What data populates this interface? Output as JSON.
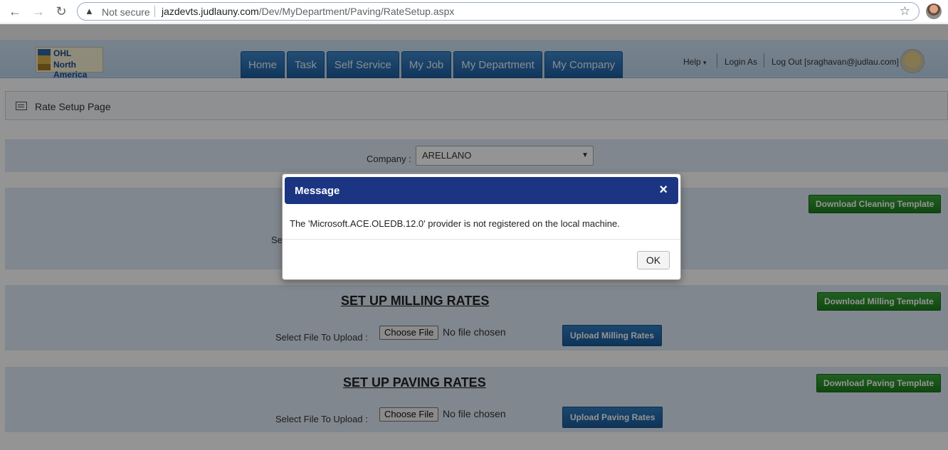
{
  "browser": {
    "security_label": "Not secure",
    "url_host": "jazdevts.judlauny.com",
    "url_path": "/Dev/MyDepartment/Paving/RateSetup.aspx"
  },
  "logo": {
    "line1": "OHL",
    "line2": "North America"
  },
  "nav": {
    "items": [
      "Home",
      "Task",
      "Self Service",
      "My Job",
      "My Department",
      "My Company"
    ]
  },
  "header_links": {
    "help": "Help",
    "login_as": "Login As",
    "logout": "Log Out [sraghavan@judlau.com]"
  },
  "page": {
    "title": "Rate Setup Page"
  },
  "company": {
    "label": "Company :",
    "selected": "ARELLANO"
  },
  "sections": {
    "cleaning": {
      "download_label": "Download Cleaning Template",
      "select_label_fragment": "Se"
    },
    "milling": {
      "title": "SET UP MILLING RATES",
      "select_label": "Select File To Upload :",
      "choose_label": "Choose File",
      "nofile": "No file chosen",
      "upload_label": "Upload Milling Rates",
      "download_label": "Download Milling Template"
    },
    "paving": {
      "title": "SET UP PAVING RATES",
      "select_label": "Select File To Upload :",
      "choose_label": "Choose File",
      "nofile": "No file chosen",
      "upload_label": "Upload Paving Rates",
      "download_label": "Download Paving Template"
    }
  },
  "modal": {
    "title": "Message",
    "close": "×",
    "message": "The 'Microsoft.ACE.OLEDB.12.0' provider is not registered on the local machine.",
    "ok_label": "OK"
  }
}
